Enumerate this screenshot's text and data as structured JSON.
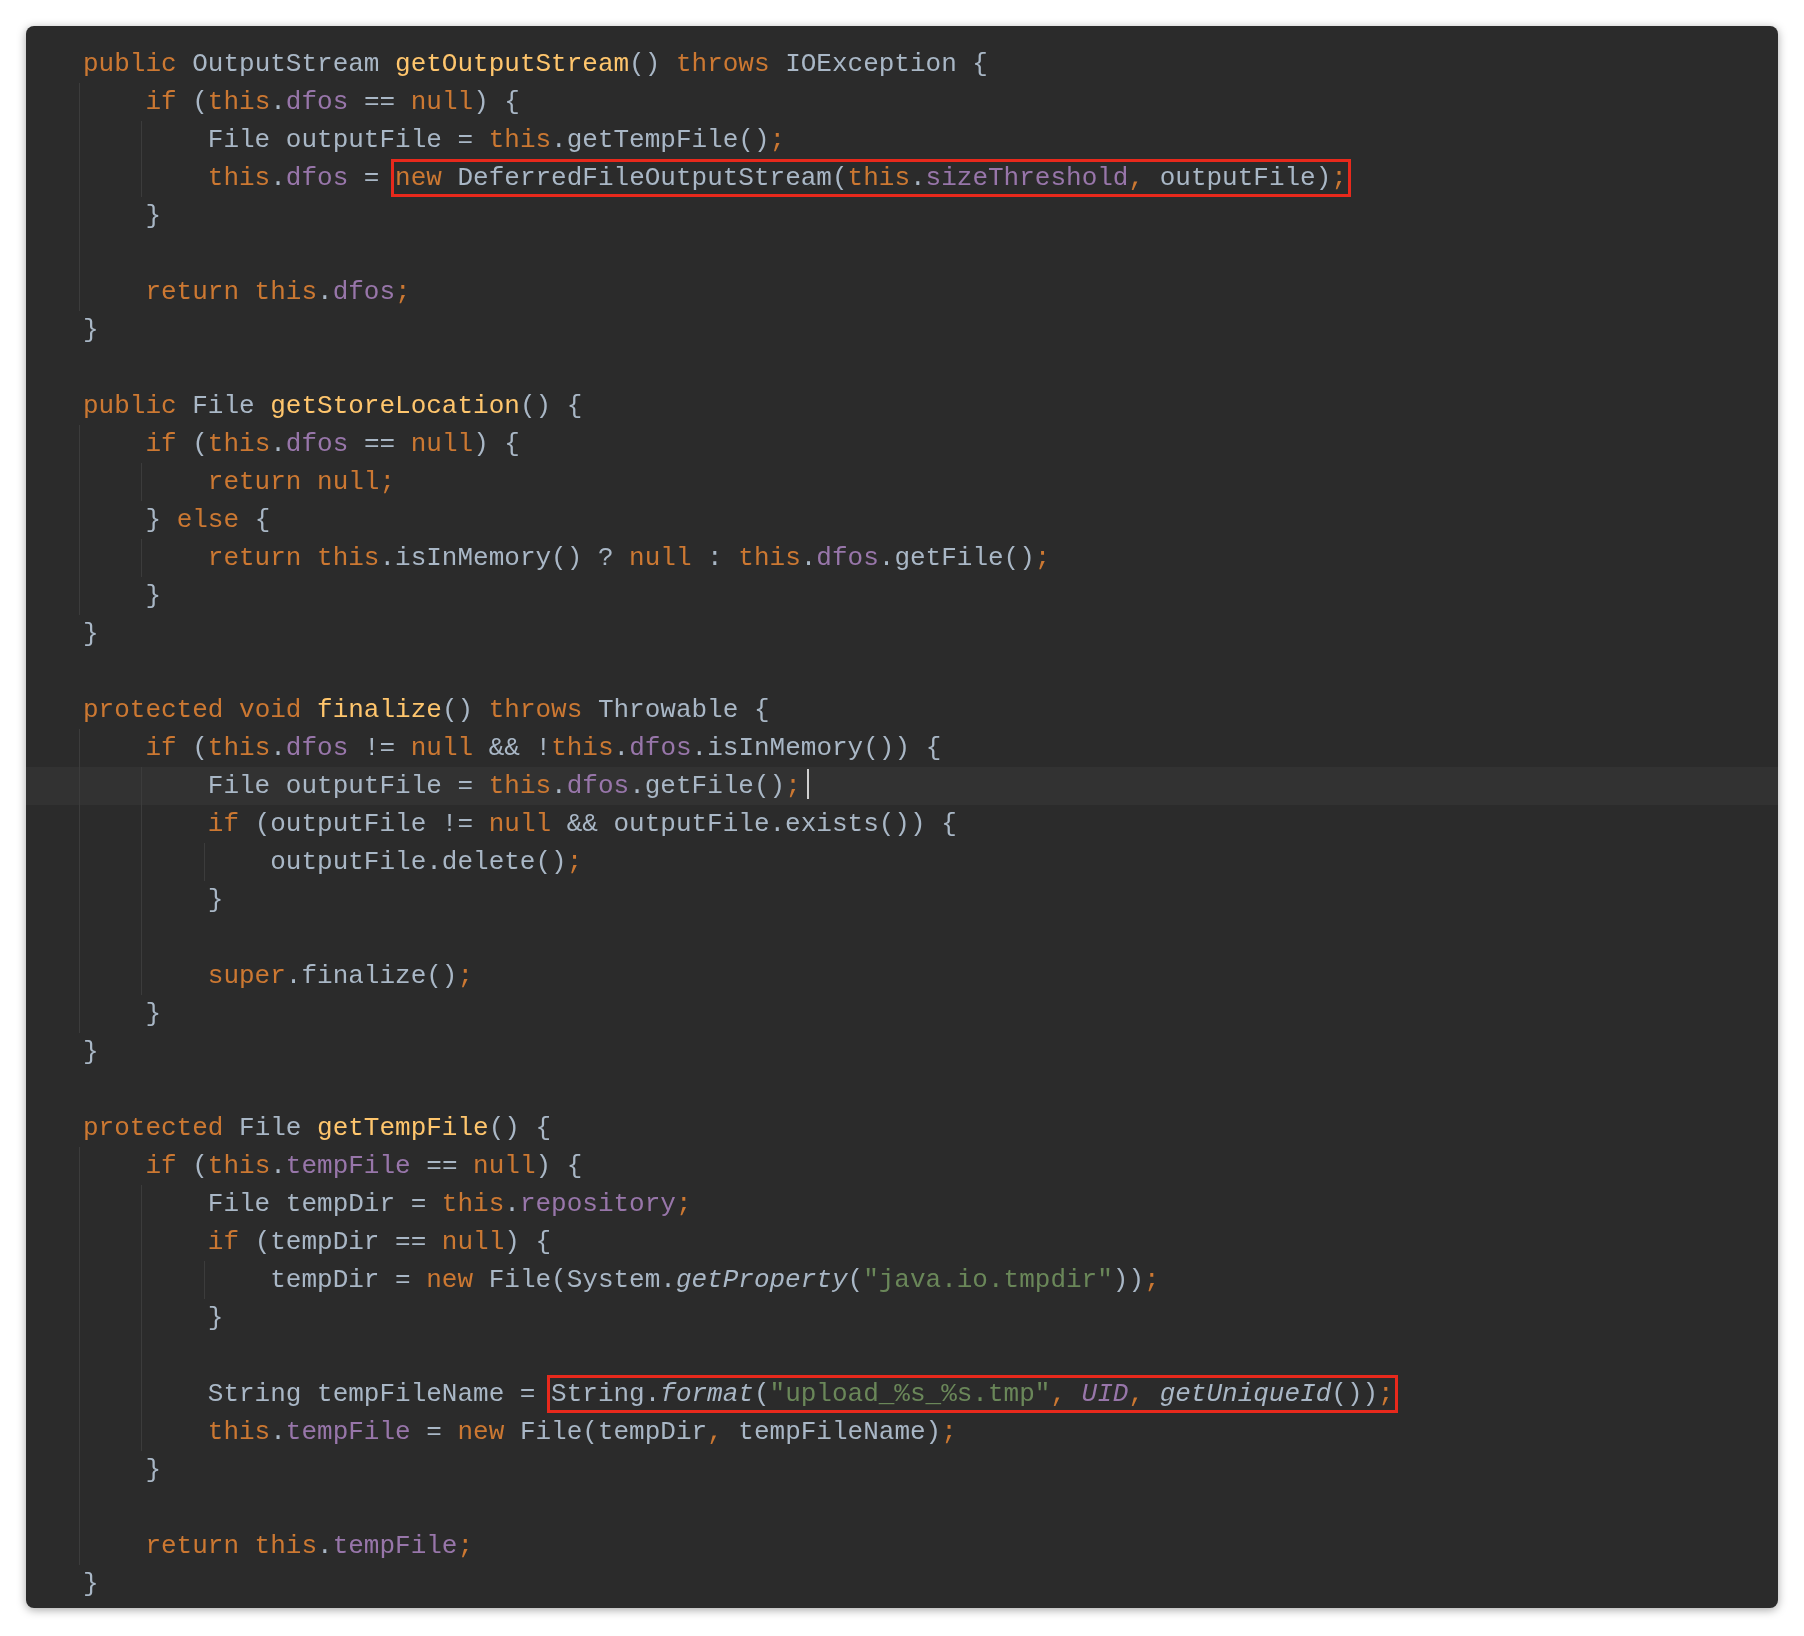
{
  "editor": {
    "lines": [
      {
        "current": false,
        "segments": [
          {
            "kind": "keyword",
            "text": "public "
          },
          {
            "kind": "plain",
            "text": "OutputStream "
          },
          {
            "kind": "declaration",
            "text": "getOutputStream"
          },
          {
            "kind": "plain",
            "text": "() "
          },
          {
            "kind": "keyword",
            "text": "throws "
          },
          {
            "kind": "plain",
            "text": "IOException {"
          }
        ]
      },
      {
        "current": false,
        "segments": [
          {
            "kind": "keyword",
            "text": "    if "
          },
          {
            "kind": "plain",
            "text": "("
          },
          {
            "kind": "keyword",
            "text": "this"
          },
          {
            "kind": "plain",
            "text": "."
          },
          {
            "kind": "field",
            "text": "dfos"
          },
          {
            "kind": "plain",
            "text": " == "
          },
          {
            "kind": "keyword",
            "text": "null"
          },
          {
            "kind": "plain",
            "text": ") {"
          }
        ]
      },
      {
        "current": false,
        "segments": [
          {
            "kind": "plain",
            "text": "        File outputFile = "
          },
          {
            "kind": "keyword",
            "text": "this"
          },
          {
            "kind": "plain",
            "text": ".getTempFile()"
          },
          {
            "kind": "keyword",
            "text": ";"
          }
        ]
      },
      {
        "current": false,
        "segments": [
          {
            "kind": "keyword",
            "text": "        this"
          },
          {
            "kind": "plain",
            "text": "."
          },
          {
            "kind": "field",
            "text": "dfos"
          },
          {
            "kind": "plain",
            "text": " = "
          },
          {
            "kind": "box",
            "parts": [
              {
                "kind": "keyword",
                "text": "new "
              },
              {
                "kind": "plain",
                "text": "DeferredFileOutputStream("
              },
              {
                "kind": "keyword",
                "text": "this"
              },
              {
                "kind": "plain",
                "text": "."
              },
              {
                "kind": "field",
                "text": "sizeThreshold"
              },
              {
                "kind": "keyword",
                "text": ", "
              },
              {
                "kind": "plain",
                "text": "outputFile)"
              },
              {
                "kind": "keyword",
                "text": ";"
              }
            ]
          }
        ]
      },
      {
        "current": false,
        "segments": [
          {
            "kind": "plain",
            "text": "    }"
          }
        ]
      },
      {
        "current": false
      },
      {
        "current": false,
        "segments": [
          {
            "kind": "keyword",
            "text": "    return this"
          },
          {
            "kind": "plain",
            "text": "."
          },
          {
            "kind": "field",
            "text": "dfos"
          },
          {
            "kind": "keyword",
            "text": ";"
          }
        ]
      },
      {
        "current": false,
        "segments": [
          {
            "kind": "plain",
            "text": "}"
          }
        ]
      },
      {
        "current": false
      },
      {
        "current": false,
        "segments": [
          {
            "kind": "keyword",
            "text": "public "
          },
          {
            "kind": "plain",
            "text": "File "
          },
          {
            "kind": "declaration",
            "text": "getStoreLocation"
          },
          {
            "kind": "plain",
            "text": "() {"
          }
        ]
      },
      {
        "current": false,
        "segments": [
          {
            "kind": "keyword",
            "text": "    if "
          },
          {
            "kind": "plain",
            "text": "("
          },
          {
            "kind": "keyword",
            "text": "this"
          },
          {
            "kind": "plain",
            "text": "."
          },
          {
            "kind": "field",
            "text": "dfos"
          },
          {
            "kind": "plain",
            "text": " == "
          },
          {
            "kind": "keyword",
            "text": "null"
          },
          {
            "kind": "plain",
            "text": ") {"
          }
        ]
      },
      {
        "current": false,
        "segments": [
          {
            "kind": "keyword",
            "text": "        return null;"
          }
        ]
      },
      {
        "current": false,
        "segments": [
          {
            "kind": "plain",
            "text": "    } "
          },
          {
            "kind": "keyword",
            "text": "else "
          },
          {
            "kind": "plain",
            "text": "{"
          }
        ]
      },
      {
        "current": false,
        "segments": [
          {
            "kind": "keyword",
            "text": "        return this"
          },
          {
            "kind": "plain",
            "text": ".isInMemory() ? "
          },
          {
            "kind": "keyword",
            "text": "null "
          },
          {
            "kind": "plain",
            "text": ": "
          },
          {
            "kind": "keyword",
            "text": "this"
          },
          {
            "kind": "plain",
            "text": "."
          },
          {
            "kind": "field",
            "text": "dfos"
          },
          {
            "kind": "plain",
            "text": ".getFile()"
          },
          {
            "kind": "keyword",
            "text": ";"
          }
        ]
      },
      {
        "current": false,
        "segments": [
          {
            "kind": "plain",
            "text": "    }"
          }
        ]
      },
      {
        "current": false,
        "segments": [
          {
            "kind": "plain",
            "text": "}"
          }
        ]
      },
      {
        "current": false
      },
      {
        "current": false,
        "segments": [
          {
            "kind": "keyword",
            "text": "protected void "
          },
          {
            "kind": "declaration",
            "text": "finalize"
          },
          {
            "kind": "plain",
            "text": "() "
          },
          {
            "kind": "keyword",
            "text": "throws "
          },
          {
            "kind": "plain",
            "text": "Throwable {"
          }
        ]
      },
      {
        "current": false,
        "segments": [
          {
            "kind": "keyword",
            "text": "    if "
          },
          {
            "kind": "plain",
            "text": "("
          },
          {
            "kind": "keyword",
            "text": "this"
          },
          {
            "kind": "plain",
            "text": "."
          },
          {
            "kind": "field",
            "text": "dfos"
          },
          {
            "kind": "plain",
            "text": " != "
          },
          {
            "kind": "keyword",
            "text": "null "
          },
          {
            "kind": "plain",
            "text": "&& !"
          },
          {
            "kind": "keyword",
            "text": "this"
          },
          {
            "kind": "plain",
            "text": "."
          },
          {
            "kind": "field",
            "text": "dfos"
          },
          {
            "kind": "plain",
            "text": ".isInMemory()) {"
          }
        ]
      },
      {
        "current": true,
        "segments": [
          {
            "kind": "plain",
            "text": "        File outputFile = "
          },
          {
            "kind": "keyword",
            "text": "this"
          },
          {
            "kind": "plain",
            "text": "."
          },
          {
            "kind": "field",
            "text": "dfos"
          },
          {
            "kind": "plain",
            "text": ".getFile()"
          },
          {
            "kind": "keyword",
            "text": ";"
          }
        ]
      },
      {
        "current": false,
        "segments": [
          {
            "kind": "keyword",
            "text": "        if "
          },
          {
            "kind": "plain",
            "text": "(outputFile != "
          },
          {
            "kind": "keyword",
            "text": "null "
          },
          {
            "kind": "plain",
            "text": "&& outputFile.exists()) {"
          }
        ]
      },
      {
        "current": false,
        "segments": [
          {
            "kind": "plain",
            "text": "            outputFile.delete()"
          },
          {
            "kind": "keyword",
            "text": ";"
          }
        ]
      },
      {
        "current": false,
        "segments": [
          {
            "kind": "plain",
            "text": "        }"
          }
        ]
      },
      {
        "current": false
      },
      {
        "current": false,
        "segments": [
          {
            "kind": "keyword",
            "text": "        super"
          },
          {
            "kind": "plain",
            "text": ".finalize()"
          },
          {
            "kind": "keyword",
            "text": ";"
          }
        ]
      },
      {
        "current": false,
        "segments": [
          {
            "kind": "plain",
            "text": "    }"
          }
        ]
      },
      {
        "current": false,
        "segments": [
          {
            "kind": "plain",
            "text": "}"
          }
        ]
      },
      {
        "current": false
      },
      {
        "current": false,
        "segments": [
          {
            "kind": "keyword",
            "text": "protected "
          },
          {
            "kind": "plain",
            "text": "File "
          },
          {
            "kind": "declaration",
            "text": "getTempFile"
          },
          {
            "kind": "plain",
            "text": "() {"
          }
        ]
      },
      {
        "current": false,
        "segments": [
          {
            "kind": "keyword",
            "text": "    if "
          },
          {
            "kind": "plain",
            "text": "("
          },
          {
            "kind": "keyword",
            "text": "this"
          },
          {
            "kind": "plain",
            "text": "."
          },
          {
            "kind": "field",
            "text": "tempFile"
          },
          {
            "kind": "plain",
            "text": " == "
          },
          {
            "kind": "keyword",
            "text": "null"
          },
          {
            "kind": "plain",
            "text": ") {"
          }
        ]
      },
      {
        "current": false,
        "segments": [
          {
            "kind": "plain",
            "text": "        File tempDir = "
          },
          {
            "kind": "keyword",
            "text": "this"
          },
          {
            "kind": "plain",
            "text": "."
          },
          {
            "kind": "field",
            "text": "repository"
          },
          {
            "kind": "keyword",
            "text": ";"
          }
        ]
      },
      {
        "current": false,
        "segments": [
          {
            "kind": "keyword",
            "text": "        if "
          },
          {
            "kind": "plain",
            "text": "(tempDir == "
          },
          {
            "kind": "keyword",
            "text": "null"
          },
          {
            "kind": "plain",
            "text": ") {"
          }
        ]
      },
      {
        "current": false,
        "segments": [
          {
            "kind": "plain",
            "text": "            tempDir = "
          },
          {
            "kind": "keyword",
            "text": "new "
          },
          {
            "kind": "plain",
            "text": "File(System."
          },
          {
            "kind": "italic",
            "text": "getProperty"
          },
          {
            "kind": "plain",
            "text": "("
          },
          {
            "kind": "string",
            "text": "\"java.io.tmpdir\""
          },
          {
            "kind": "plain",
            "text": "))"
          },
          {
            "kind": "keyword",
            "text": ";"
          }
        ]
      },
      {
        "current": false,
        "segments": [
          {
            "kind": "plain",
            "text": "        }"
          }
        ]
      },
      {
        "current": false
      },
      {
        "current": false,
        "segments": [
          {
            "kind": "plain",
            "text": "        String tempFileName = "
          },
          {
            "kind": "box",
            "parts": [
              {
                "kind": "plain",
                "text": "String."
              },
              {
                "kind": "italic",
                "text": "format"
              },
              {
                "kind": "plain",
                "text": "("
              },
              {
                "kind": "string",
                "text": "\"upload_%s_%s.tmp\""
              },
              {
                "kind": "keyword",
                "text": ", "
              },
              {
                "kind": "constant",
                "text": "UID"
              },
              {
                "kind": "keyword",
                "text": ", "
              },
              {
                "kind": "italic",
                "text": "getUniqueId"
              },
              {
                "kind": "plain",
                "text": "())"
              },
              {
                "kind": "keyword",
                "text": ";"
              }
            ]
          }
        ]
      },
      {
        "current": false,
        "segments": [
          {
            "kind": "keyword",
            "text": "        this"
          },
          {
            "kind": "plain",
            "text": "."
          },
          {
            "kind": "field",
            "text": "tempFile"
          },
          {
            "kind": "plain",
            "text": " = "
          },
          {
            "kind": "keyword",
            "text": "new "
          },
          {
            "kind": "plain",
            "text": "File(tempDir"
          },
          {
            "kind": "keyword",
            "text": ", "
          },
          {
            "kind": "plain",
            "text": "tempFileName)"
          },
          {
            "kind": "keyword",
            "text": ";"
          }
        ]
      },
      {
        "current": false,
        "segments": [
          {
            "kind": "plain",
            "text": "    }"
          }
        ]
      },
      {
        "current": false
      },
      {
        "current": false,
        "segments": [
          {
            "kind": "keyword",
            "text": "    return this"
          },
          {
            "kind": "plain",
            "text": "."
          },
          {
            "kind": "field",
            "text": "tempFile"
          },
          {
            "kind": "keyword",
            "text": ";"
          }
        ]
      },
      {
        "current": false,
        "segments": [
          {
            "kind": "plain",
            "text": "}"
          }
        ]
      }
    ]
  }
}
